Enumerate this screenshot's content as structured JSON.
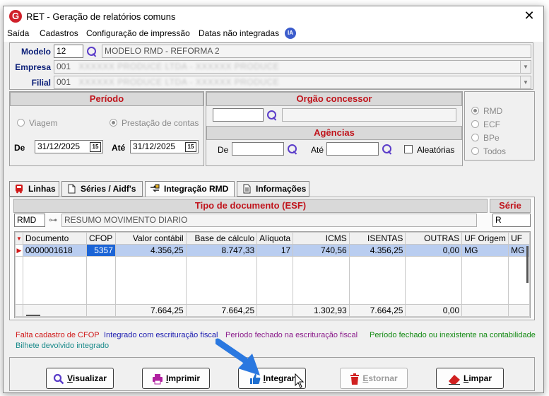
{
  "window": {
    "title": "RET - Geração de relatórios comuns",
    "app_logo": "G"
  },
  "menu": {
    "items": [
      "Saída",
      "Cadastros",
      "Configuração de impressão",
      "Datas não integradas"
    ],
    "ia_badge": "IA"
  },
  "header": {
    "modelo_label": "Modelo",
    "modelo_code": "12",
    "modelo_desc": "MODELO RMD - REFORMA 2",
    "empresa_label": "Empresa",
    "empresa_code": "001",
    "empresa_name": "XXXXXX PRODUCE LTDA - XXXXXX PRODUCE",
    "filial_label": "Filial",
    "filial_code": "001",
    "filial_name": "XXXXXX PRODUCE LTDA - XXXXXX PRODUCE"
  },
  "periodo": {
    "title": "Período",
    "option_viagem": "Viagem",
    "option_prestacao": "Prestação de contas",
    "de_label": "De",
    "de_value": "31/12/2025",
    "ate_label": "Até",
    "ate_value": "31/12/2025",
    "cal_glyph": "15"
  },
  "orgao": {
    "title": "Orgão concessor",
    "code": "",
    "name": ""
  },
  "agencias": {
    "title": "Agências",
    "de_label": "De",
    "ate_label": "Até",
    "aleatorias_label": "Aleatórias",
    "aleatorias_checked": false
  },
  "tipo_relatorio": {
    "options": [
      "RMD",
      "ECF",
      "BPe",
      "Todos"
    ],
    "selected": "RMD"
  },
  "tabs": [
    {
      "label": "Linhas",
      "icon": "bus-icon"
    },
    {
      "label": "Séries / Aidf's",
      "icon": "document-icon"
    },
    {
      "label": "Integração RMD",
      "icon": "integration-icon",
      "active": true
    },
    {
      "label": "Informações",
      "icon": "info-doc-icon"
    }
  ],
  "tipo_documento": {
    "title": "Tipo de documento (ESF)",
    "code": "RMD",
    "desc": "RESUMO MOVIMENTO DIARIO",
    "serie_title": "Série",
    "serie_value": "R"
  },
  "grid": {
    "columns": [
      "Documento",
      "CFOP",
      "Valor contábil",
      "Base de cálculo",
      "Alíquota",
      "ICMS",
      "ISENTAS",
      "OUTRAS",
      "UF Origem",
      "UF"
    ],
    "rows": [
      [
        "0000001618",
        "5357",
        "4.356,25",
        "8.747,33",
        "17",
        "740,56",
        "4.356,25",
        "0,00",
        "MG",
        "MG"
      ]
    ],
    "totals": [
      "",
      "",
      "7.664,25",
      "7.664,25",
      "",
      "1.302,93",
      "7.664,25",
      "0,00",
      "",
      ""
    ]
  },
  "legend": {
    "falta_cfop": "Falta cadastro de CFOP",
    "integrado": "Integrado com escrituração fiscal",
    "periodo_fechado_escr": "Período fechado na escrituração fiscal",
    "periodo_fechado_cont": "Período fechado ou inexistente na contabilidade",
    "bilhete": "Bilhete devolvido integrado"
  },
  "legend_colors": {
    "falta_cfop": "#d01818",
    "integrado": "#1a1ab0",
    "periodo_fechado_escr": "#8a1a8a",
    "periodo_fechado_cont": "#128a12",
    "bilhete": "#1a8a8a"
  },
  "buttons": {
    "visualizar": {
      "first": "V",
      "rest": "isualizar"
    },
    "imprimir": {
      "first": "I",
      "rest": "mprimir"
    },
    "integrar": {
      "first": "I",
      "rest": "ntegrar"
    },
    "estornar": {
      "first": "E",
      "rest": "stornar"
    },
    "limpar": {
      "first": "L",
      "rest": "impar"
    }
  }
}
